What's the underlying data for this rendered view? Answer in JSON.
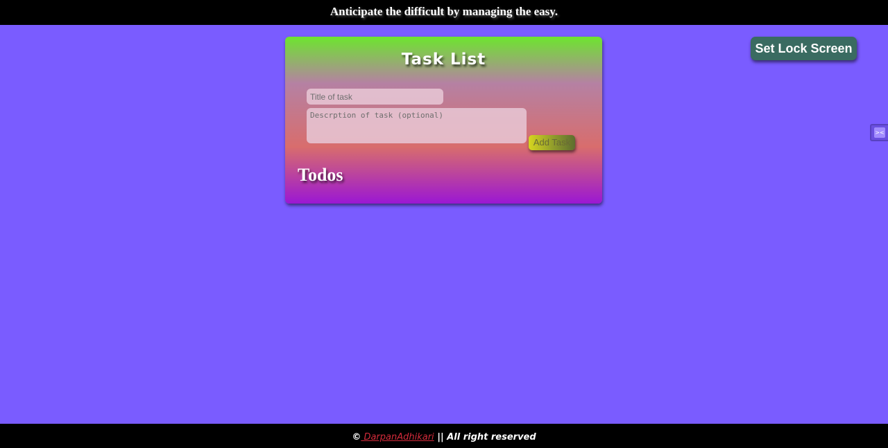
{
  "header": {
    "quote": "Anticipate the difficult by managing the easy."
  },
  "lock_screen": {
    "button_label": "Set Lock Screen"
  },
  "task_card": {
    "title": "Task List",
    "title_placeholder": "Title of task",
    "description_placeholder": "Descrption of task (optional)",
    "add_button_label": "Add Task",
    "todos_heading": "Todos"
  },
  "side_widget": {
    "icon": "face-icon"
  },
  "footer": {
    "copyright_symbol": "©",
    "author_link": " DarpanAdhikari",
    "rights_text": " || All right reserved"
  },
  "colors": {
    "page_background": "#7a5cff",
    "bar_background": "#000000",
    "lock_button": "#3a6b61",
    "author_link": "#d42b3b",
    "card_gradient": [
      "#6de52e",
      "#b581a3",
      "#d86d6d",
      "#9b17d3"
    ]
  }
}
